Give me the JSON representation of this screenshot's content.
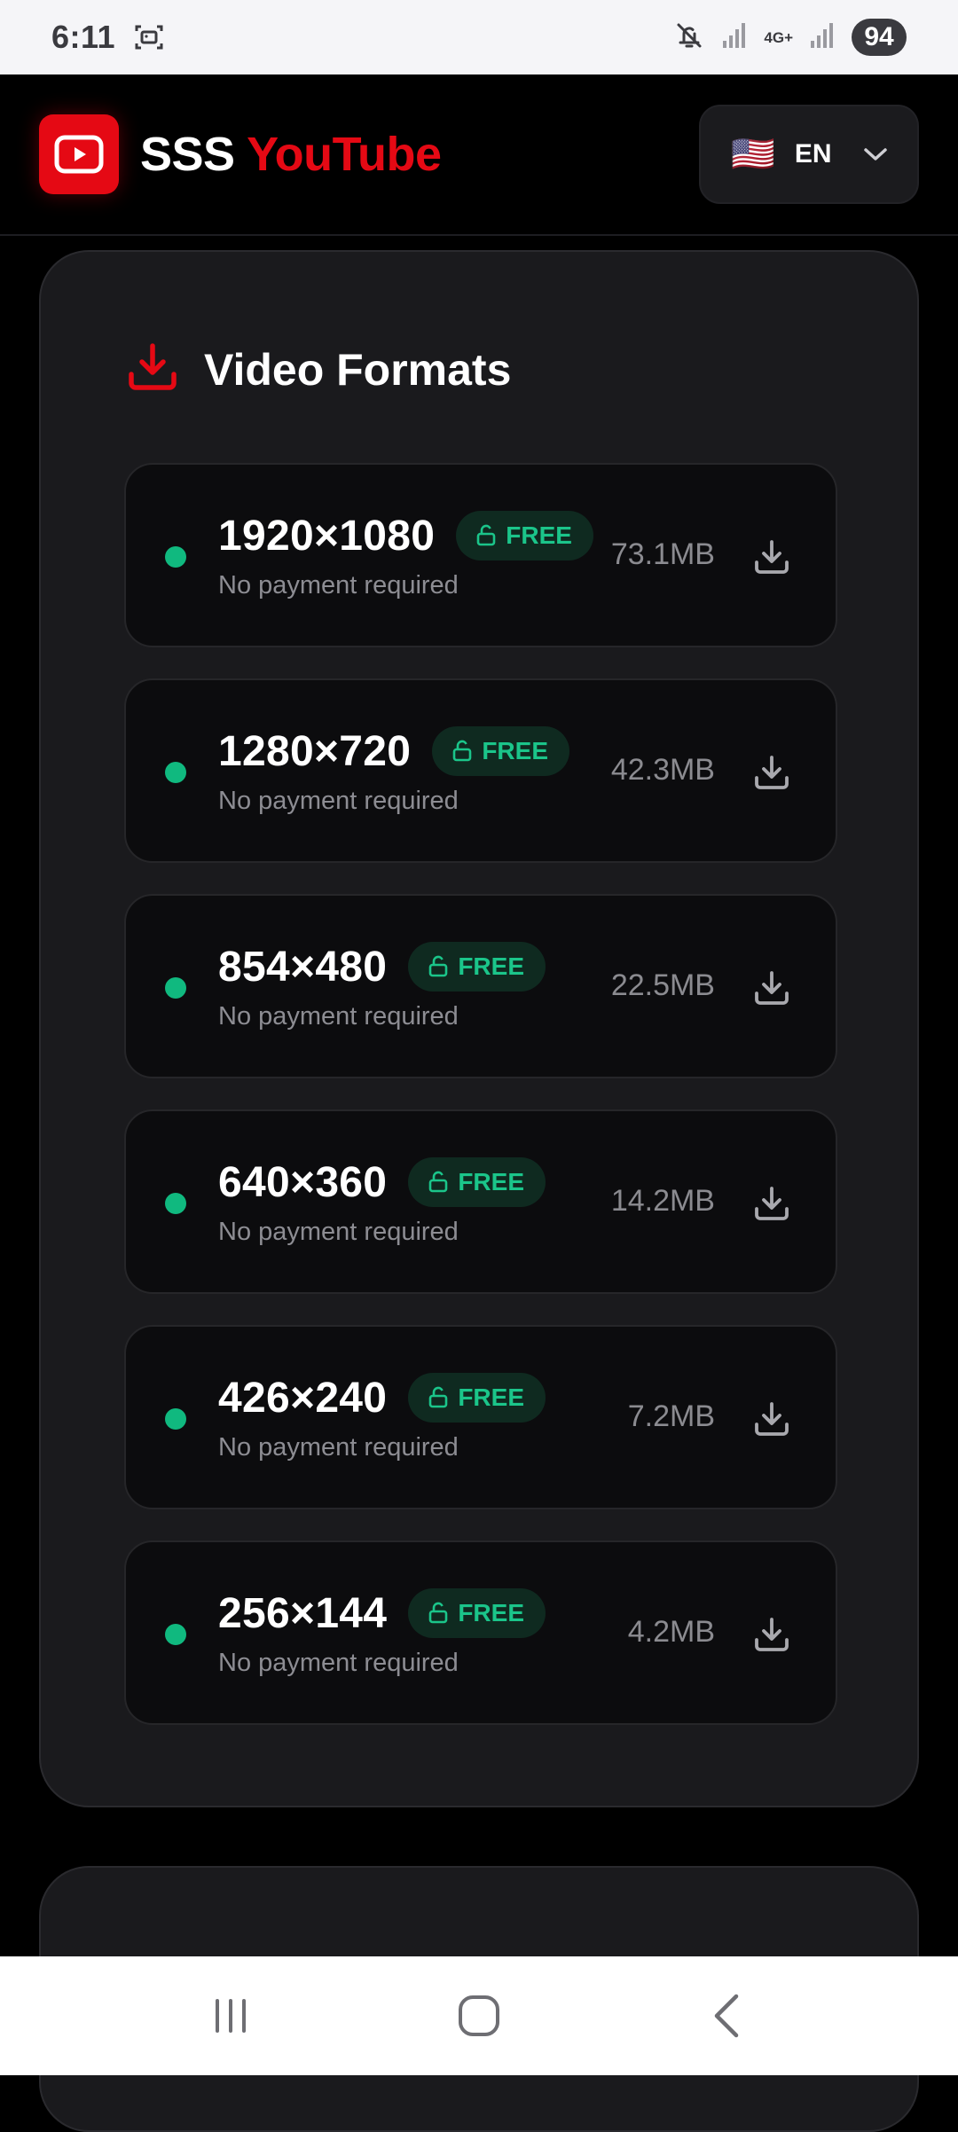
{
  "status_bar": {
    "time": "6:11",
    "network": "4G+",
    "battery": "94",
    "icons": [
      "screenshot-icon",
      "mute-icon",
      "signal-icon",
      "signal-icon"
    ]
  },
  "header": {
    "brand_primary": "SSS",
    "brand_accent": "YouTube",
    "lang_flag": "🇺🇸",
    "lang_code": "EN",
    "colors": {
      "brand": "#e50914",
      "background": "#000000"
    }
  },
  "formats": {
    "title": "Video Formats",
    "colors": {
      "accent": "#e50914",
      "free": "#1bc58a",
      "dot": "#10b97f"
    },
    "items": [
      {
        "resolution": "1920×1080",
        "badge": "FREE",
        "note": "No payment required",
        "size": "73.1MB"
      },
      {
        "resolution": "1280×720",
        "badge": "FREE",
        "note": "No payment required",
        "size": "42.3MB"
      },
      {
        "resolution": "854×480",
        "badge": "FREE",
        "note": "No payment required",
        "size": "22.5MB"
      },
      {
        "resolution": "640×360",
        "badge": "FREE",
        "note": "No payment required",
        "size": "14.2MB"
      },
      {
        "resolution": "426×240",
        "badge": "FREE",
        "note": "No payment required",
        "size": "7.2MB"
      },
      {
        "resolution": "256×144",
        "badge": "FREE",
        "note": "No payment required",
        "size": "4.2MB"
      }
    ]
  },
  "nav": {
    "buttons": [
      "recents-icon",
      "home-icon",
      "back-icon"
    ]
  }
}
